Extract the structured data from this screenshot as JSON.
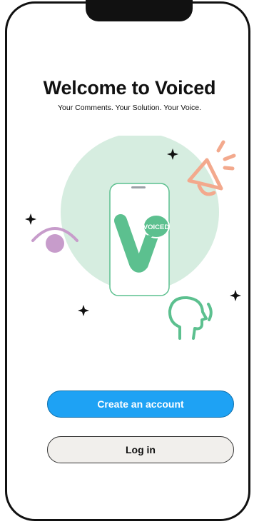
{
  "welcome": {
    "title": "Welcome to Voiced",
    "tagline": "Your Comments. Your Solution. Your Voice."
  },
  "illustration": {
    "logo_bubble_text": "VOICED",
    "colors": {
      "circle": "#d6ede0",
      "brand_green": "#5cc08f",
      "eye_purple": "#c79ccb",
      "megaphone_orange": "#f3a98d",
      "sparkle": "#111111"
    },
    "icons": [
      "megaphone-icon",
      "eye-icon",
      "speaking-head-icon",
      "sparkle-icon"
    ]
  },
  "actions": {
    "create_account_label": "Create an account",
    "login_label": "Log in"
  },
  "colors": {
    "primary_button": "#1ea2f4",
    "secondary_button": "#f1efec"
  }
}
